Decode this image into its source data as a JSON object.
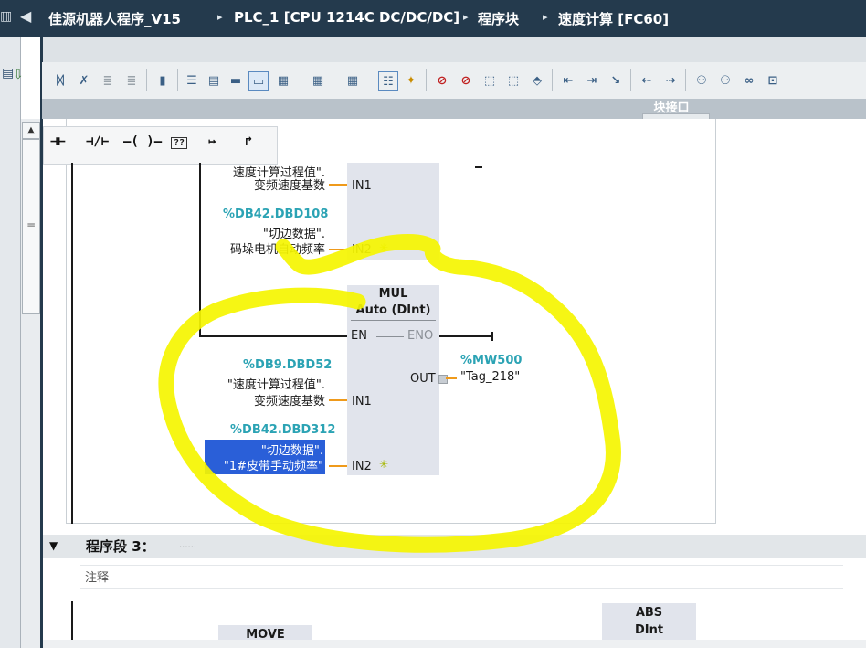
{
  "breadcrumb": {
    "project": "佳源机器人程序_V15",
    "plc": "PLC_1 [CPU 1214C DC/DC/DC]",
    "folder": "程序块",
    "block": "速度计算 [FC60]",
    "separator": "▸"
  },
  "interface_bar": {
    "label": "块接口"
  },
  "lad_toolbar": {
    "items": [
      {
        "name": "normally-open-contact",
        "glyph": "⊣⊢"
      },
      {
        "name": "normally-closed-contact",
        "glyph": "⊣/⊢"
      },
      {
        "name": "coil",
        "glyph": "–( )–"
      },
      {
        "name": "empty-box",
        "glyph": "??"
      },
      {
        "name": "open-branch",
        "glyph": "↦"
      },
      {
        "name": "close-branch",
        "glyph": "↱"
      }
    ]
  },
  "network2": {
    "upper_box": {
      "in1_tag_line1": "速度计算过程值\".",
      "in1_tag_line2": "变频速度基数",
      "in1_pin": "IN1",
      "in2_addr": "%DB42.DBD108",
      "in2_tag_line1": "\"切边数据\".",
      "in2_tag_line2": "码垛电机自动频率",
      "in2_pin": "IN2"
    },
    "mul_box": {
      "name": "MUL",
      "type": "Auto (DInt)",
      "en": "EN",
      "eno": "ENO",
      "out_pin": "OUT",
      "out_addr": "%MW500",
      "out_tag": "\"Tag_218\"",
      "in1_addr": "%DB9.DBD52",
      "in1_tag_line1": "\"速度计算过程值\".",
      "in1_tag_line2": "变频速度基数",
      "in1_pin": "IN1",
      "in2_addr": "%DB42.DBD312",
      "in2_tag_line1": "\"切边数据\".",
      "in2_tag_line2": "\"1#皮带手动频率\"",
      "in2_pin": "IN2"
    }
  },
  "network3": {
    "title": "程序段 3：",
    "dots": "......",
    "comment": "注释",
    "move_box": "MOVE",
    "abs_box": {
      "name": "ABS",
      "type": "DInt"
    }
  },
  "colors": {
    "title_bar": "#243a4d",
    "address": "#2ba3b4",
    "wire": "#ef9a1b",
    "box": "#e1e4ec",
    "selection": "#2a5fd8",
    "highlight": "#f7f700"
  }
}
